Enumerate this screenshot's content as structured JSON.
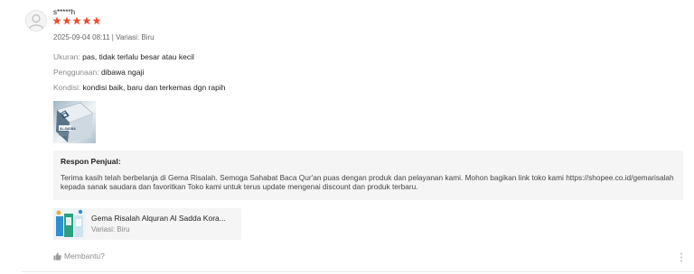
{
  "review": {
    "username": "s*****h",
    "rating": 5,
    "meta": "2025-09-04 08:11 | Variasi: Biru",
    "attributes": [
      {
        "key": "Ukuran:",
        "value": "pas, tidak terlalu besar atau kecil"
      },
      {
        "key": "Penggunaan:",
        "value": "dibawa ngaji"
      },
      {
        "key": "Kondisi:",
        "value": "kondisi baik, baru dan terkemas dgn rapih"
      }
    ],
    "photo_label": "AL-SADDA"
  },
  "seller_response": {
    "title": "Respon Penjual:",
    "text": "Terima kasih telah berbelanja di Gema Risalah. Semoga Sahabat Baca Qur'an puas dengan produk dan pelayanan kami. Mohon bagikan link toko kami https://shopee.co.id/gemarisalah kepada sanak saudara dan favoritkan Toko kami untuk terus update mengenai discount dan produk terbaru."
  },
  "product": {
    "name": "Gema Risalah Alquran Al Sadda Kora...",
    "variant": "Variasi: Biru"
  },
  "helpful": {
    "label": "Membantu?"
  },
  "colors": {
    "star": "#ee4d2d",
    "muted": "#8a8a8a",
    "panel": "#f5f5f5"
  }
}
